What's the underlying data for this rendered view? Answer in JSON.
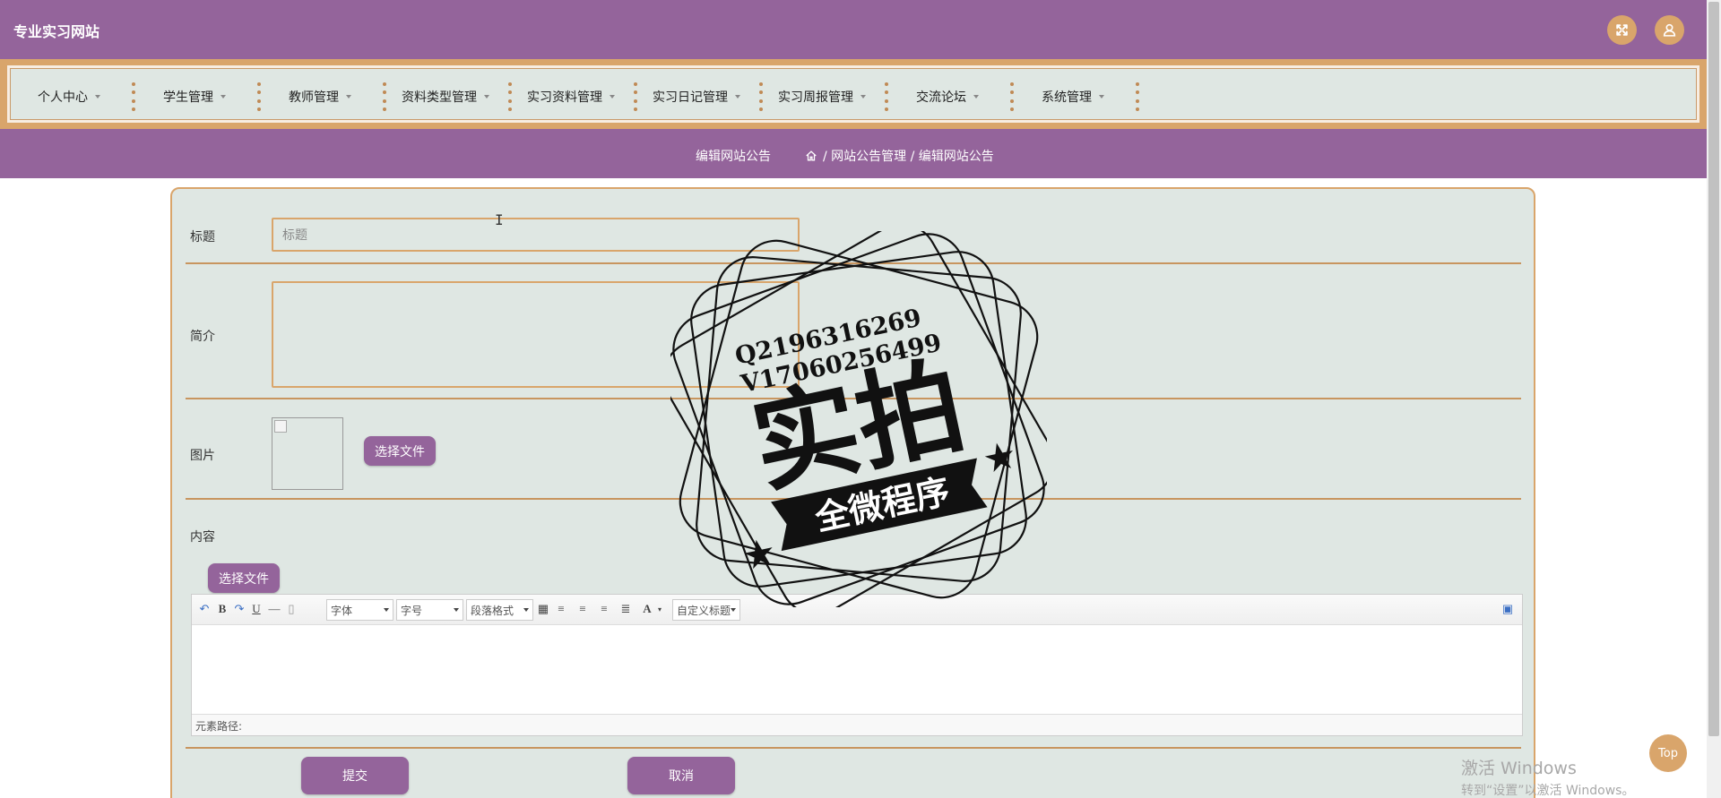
{
  "header": {
    "site_title": "专业实习网站",
    "fullscreen_icon": "fullscreen-icon",
    "user_icon": "user-icon"
  },
  "menu": [
    {
      "label": "个人中心"
    },
    {
      "label": "学生管理"
    },
    {
      "label": "教师管理"
    },
    {
      "label": "资料类型管理"
    },
    {
      "label": "实习资料管理"
    },
    {
      "label": "实习日记管理"
    },
    {
      "label": "实习周报管理"
    },
    {
      "label": "交流论坛"
    },
    {
      "label": "系统管理"
    }
  ],
  "breadcrumb": {
    "page_title": "编辑网站公告",
    "home_icon": "home-icon",
    "path": "/ 网站公告管理 / 编辑网站公告"
  },
  "form": {
    "title_label": "标题",
    "title_placeholder": "标题",
    "title_value": "",
    "intro_label": "简介",
    "intro_value": "",
    "image_label": "图片",
    "choose_file_label": "选择文件",
    "content_label": "内容",
    "content_choose_file_label": "选择文件",
    "submit_label": "提交",
    "cancel_label": "取消"
  },
  "editor": {
    "font_select": "字体",
    "size_select": "字号",
    "paragraph_select": "段落格式",
    "custom_title_select": "自定义标题",
    "status_path": "元素路径:"
  },
  "stamp": {
    "line1": "Q2196316269",
    "line2": "V17060256499",
    "big_text": "实拍",
    "ribbon_text": "全微程序"
  },
  "to_top_label": "Top",
  "windows_watermark": {
    "line1": "激活 Windows",
    "line2": "转到“设置”以激活 Windows。"
  },
  "colors": {
    "primary_purple": "#94649b",
    "accent_orange": "#d9a56b",
    "panel_bg": "#dfe7e3"
  }
}
